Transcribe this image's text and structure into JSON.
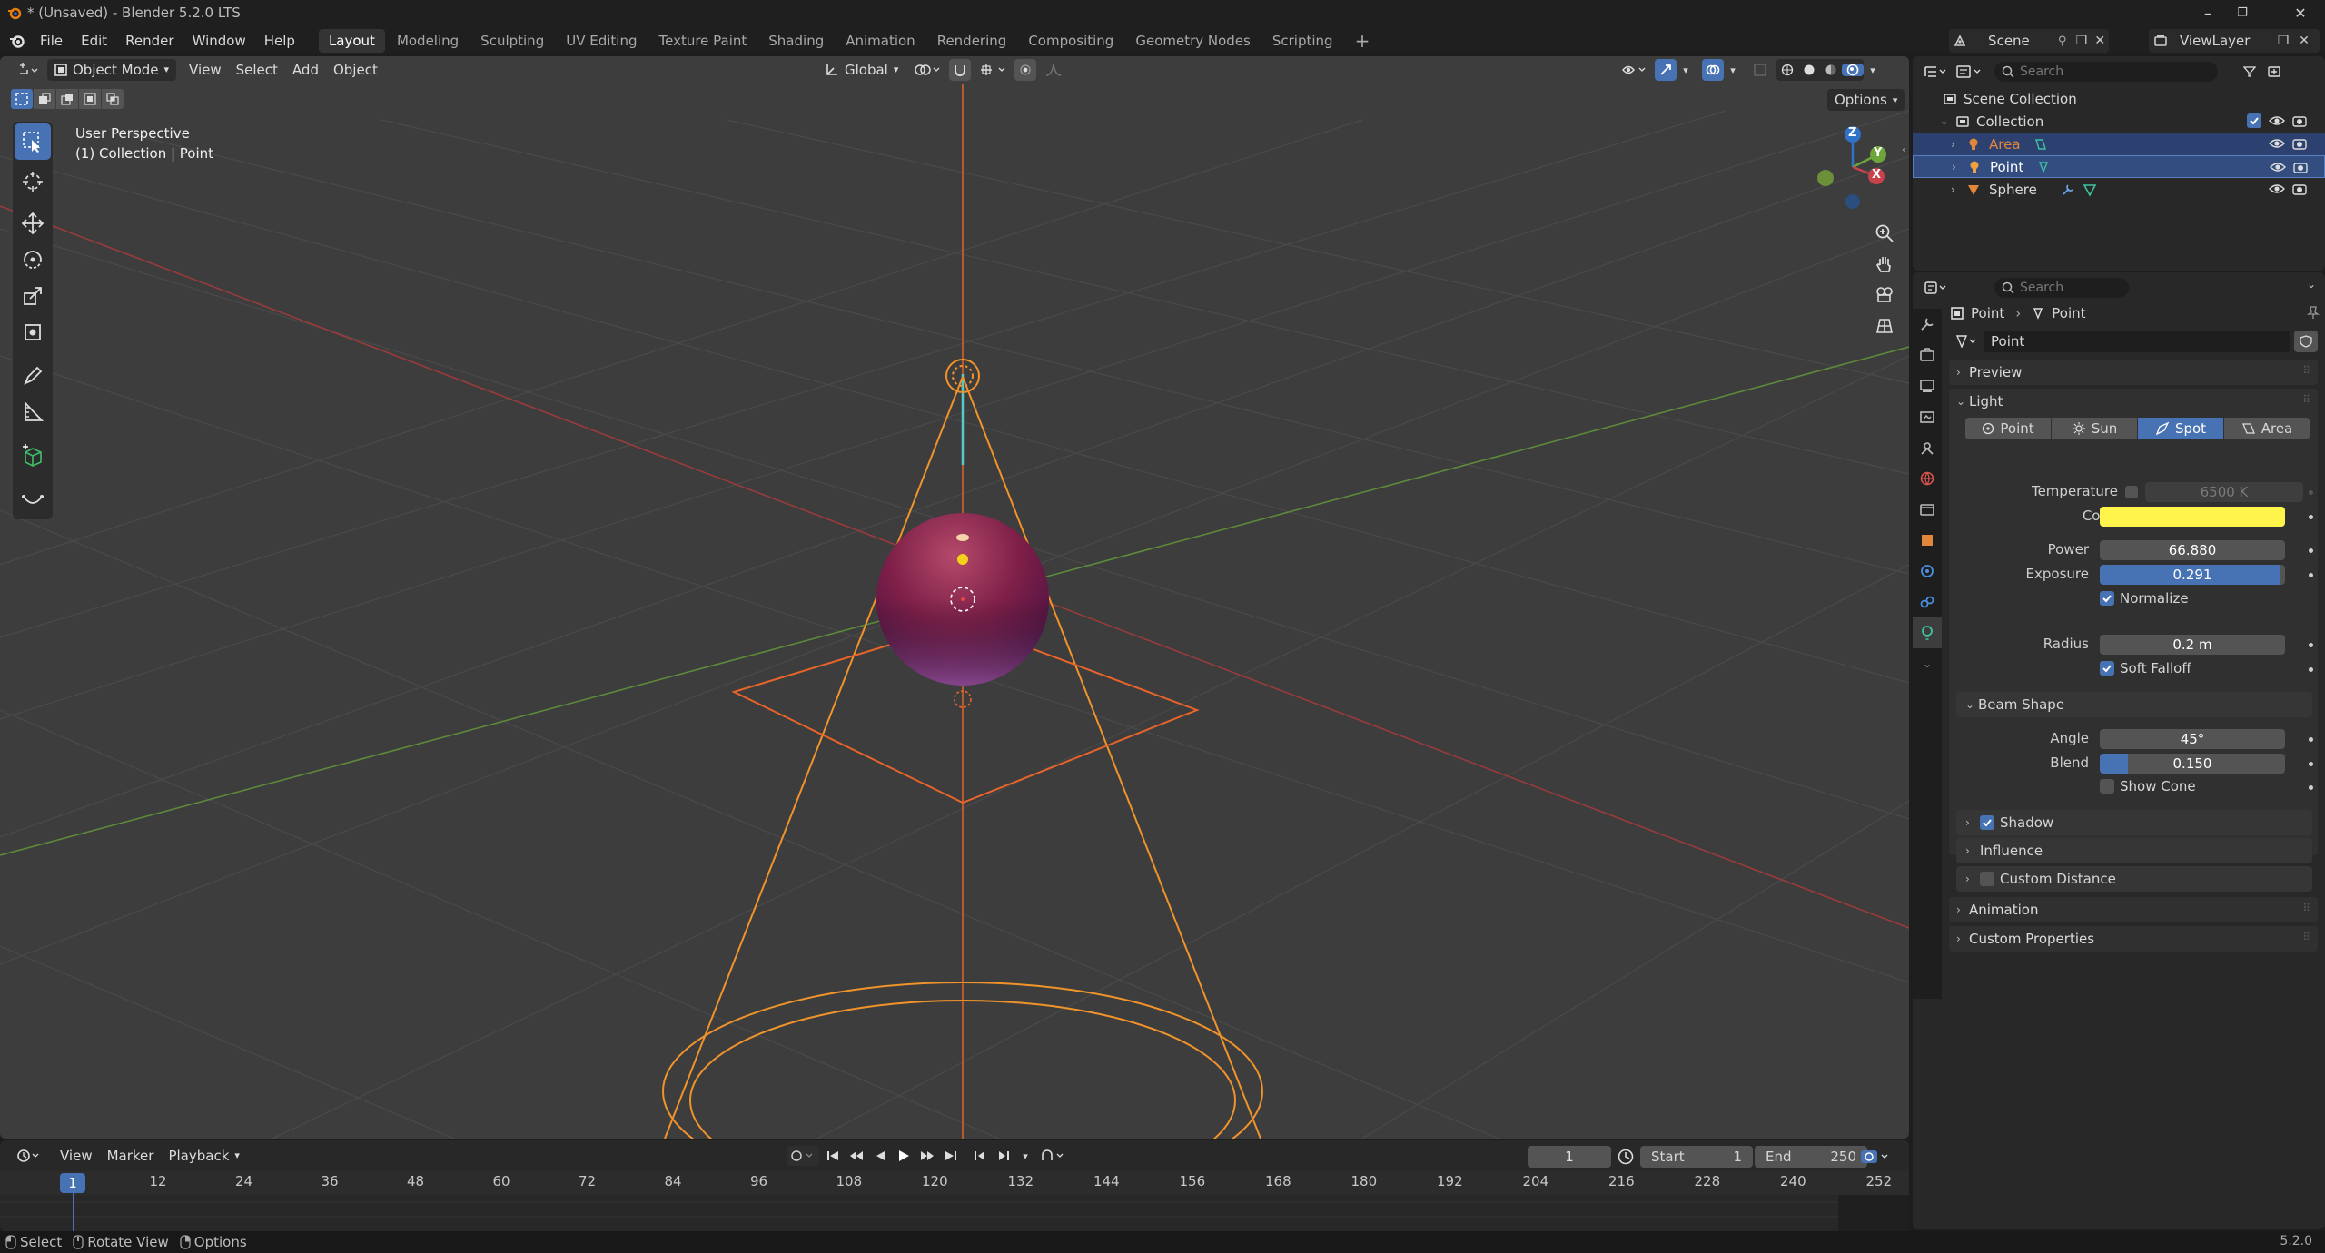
{
  "window": {
    "title": "* (Unsaved) - Blender 5.2.0 LTS"
  },
  "menu": {
    "items": [
      "File",
      "Edit",
      "Render",
      "Window",
      "Help"
    ]
  },
  "workspaces": {
    "tabs": [
      "Layout",
      "Modeling",
      "Sculpting",
      "UV Editing",
      "Texture Paint",
      "Shading",
      "Animation",
      "Rendering",
      "Compositing",
      "Geometry Nodes",
      "Scripting"
    ],
    "active": "Layout"
  },
  "scene": {
    "scene_name": "Scene",
    "view_layer": "ViewLayer"
  },
  "viewport": {
    "mode": "Object Mode",
    "menus": [
      "View",
      "Select",
      "Add",
      "Object"
    ],
    "transform_orientation": "Global",
    "options_label": "Options",
    "overlay_line1": "User Perspective",
    "overlay_line2": "(1) Collection | Point",
    "gizmo_axes": {
      "x": "X",
      "y": "Y",
      "z": "Z"
    }
  },
  "timeline": {
    "menus": [
      "View",
      "Marker",
      "Playback"
    ],
    "current_frame": "1",
    "start_label": "Start",
    "start_value": "1",
    "end_label": "End",
    "end_value": "250",
    "ruler": [
      "1",
      "12",
      "24",
      "36",
      "48",
      "60",
      "72",
      "84",
      "96",
      "108",
      "120",
      "132",
      "144",
      "156",
      "168",
      "180",
      "192",
      "204",
      "216",
      "228",
      "240",
      "252"
    ]
  },
  "statusbar": {
    "select": "Select",
    "rotate": "Rotate View",
    "options": "Options",
    "version": "5.2.0"
  },
  "outliner": {
    "search_placeholder": "Search",
    "scene_collection": "Scene Collection",
    "collection": "Collection",
    "items": [
      {
        "name": "Area",
        "color": "#e0873c"
      },
      {
        "name": "Point",
        "color": "#e8e8e8"
      },
      {
        "name": "Sphere",
        "color": "#dadada"
      }
    ]
  },
  "properties": {
    "search_placeholder": "Search",
    "breadcrumb_object": "Point",
    "breadcrumb_data": "Point",
    "datablock": "Point",
    "panels": {
      "preview": "Preview",
      "light": "Light",
      "beam_shape": "Beam Shape",
      "shadow": "Shadow",
      "influence": "Influence",
      "custom_distance": "Custom Distance",
      "animation": "Animation",
      "custom_properties": "Custom Properties"
    },
    "light_types": [
      "Point",
      "Sun",
      "Spot",
      "Area"
    ],
    "active_light_type": "Spot",
    "temperature_label": "Temperature",
    "temperature_value": "6500 K",
    "color_label": "Color",
    "color_value": "#fff44c",
    "power_label": "Power",
    "power_value": "66.880",
    "exposure_label": "Exposure",
    "exposure_value": "0.291",
    "exposure_fill": 0.97,
    "normalize_label": "Normalize",
    "radius_label": "Radius",
    "radius_value": "0.2 m",
    "soft_falloff_label": "Soft Falloff",
    "angle_label": "Angle",
    "angle_value": "45°",
    "blend_label": "Blend",
    "blend_value": "0.150",
    "blend_fill": 0.15,
    "show_cone_label": "Show Cone"
  },
  "colors": {
    "accent": "#4772b3",
    "light_orange": "#f0932b",
    "selection_orange": "#e8642a",
    "sphere": "#8a2a52"
  }
}
